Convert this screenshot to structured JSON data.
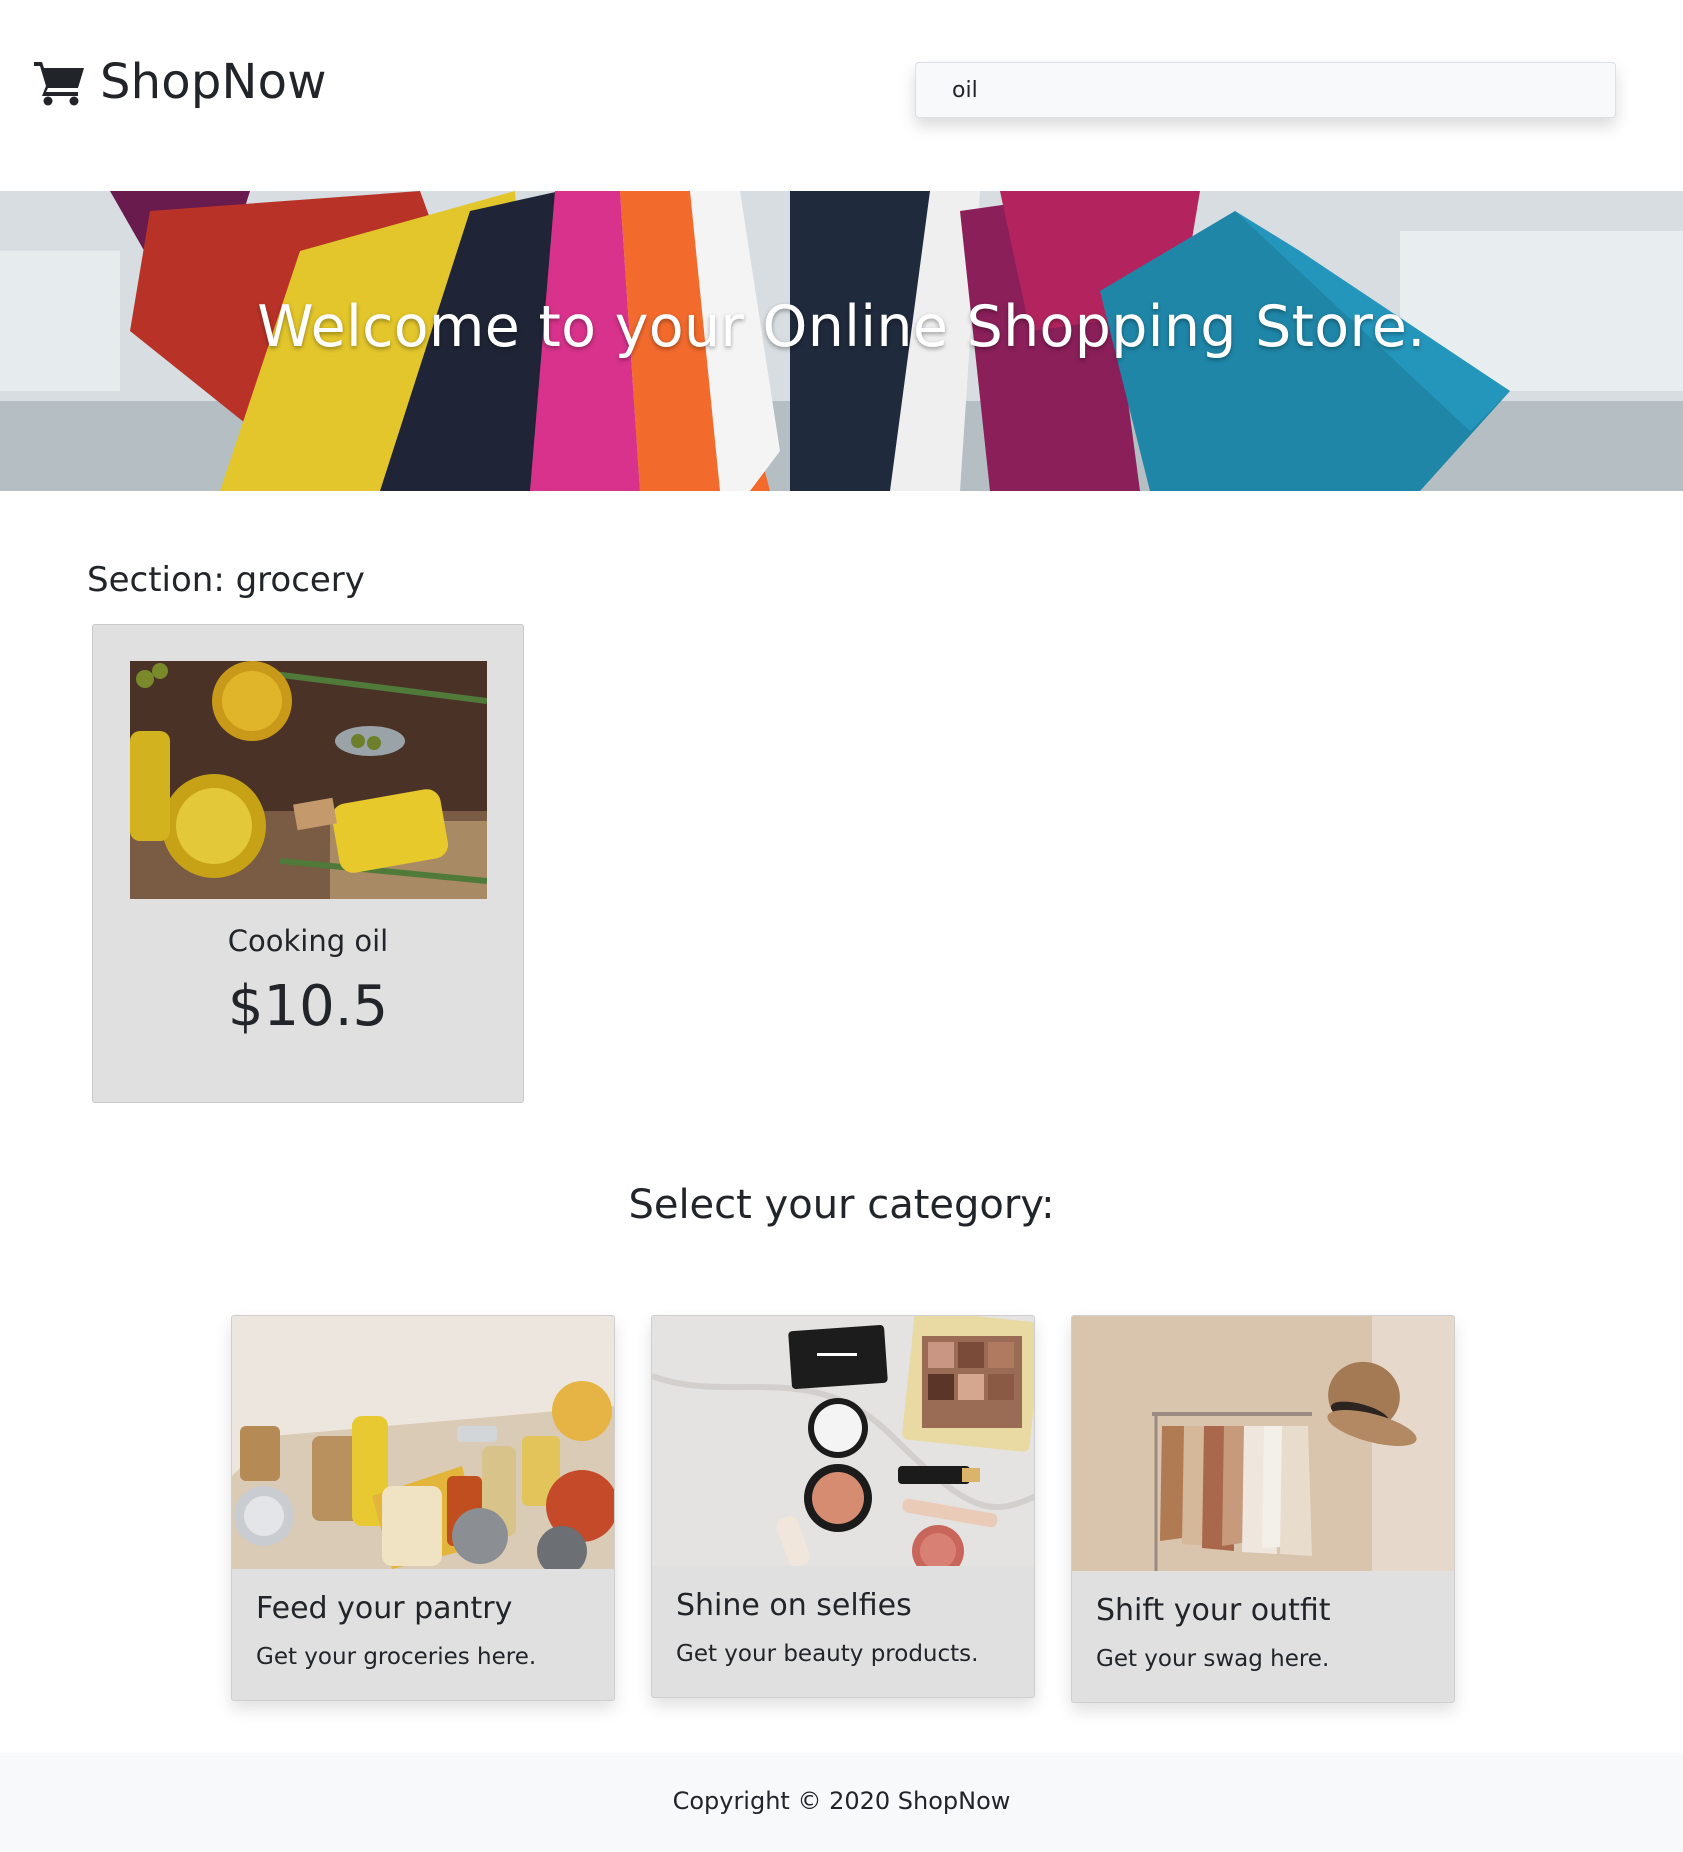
{
  "brand": {
    "name": "ShopNow",
    "icon": "cart-icon"
  },
  "search": {
    "value": "oil",
    "placeholder": ""
  },
  "hero": {
    "title": "Welcome to your Online Shopping Store."
  },
  "section": {
    "title": "Section: grocery",
    "products": [
      {
        "name": "Cooking oil",
        "price": "$10.5"
      }
    ]
  },
  "categories": {
    "heading": "Select your category:",
    "items": [
      {
        "title": "Feed your pantry",
        "text": "Get your groceries here."
      },
      {
        "title": "Shine on selfies",
        "text": "Get your beauty products."
      },
      {
        "title": "Shift your outfit",
        "text": "Get your swag here."
      }
    ]
  },
  "footer": {
    "copyright": "Copyright © 2020 ShopNow"
  },
  "colors": {
    "text": "#212529",
    "card": "#e0e0e0",
    "footer": "#f8f9fa"
  }
}
